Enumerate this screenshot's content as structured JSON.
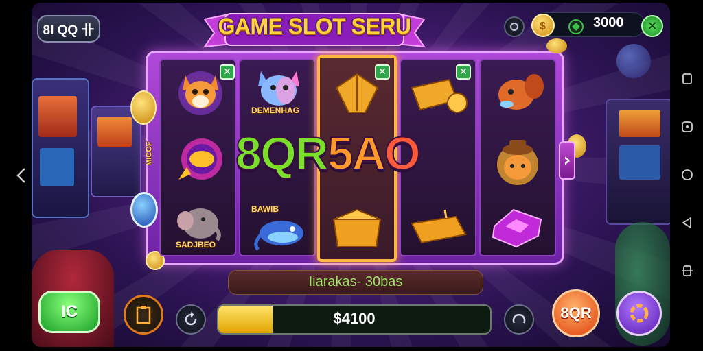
{
  "top": {
    "level_badge": "8I QQ 卝",
    "title": "GAME SLOT SERU",
    "credits": "3000"
  },
  "reels": {
    "big_win_text": [
      "8QR",
      "5A",
      "O"
    ],
    "labels": {
      "reel2_top": "DEMENHAG",
      "reel1_bottom": "SADJBEO",
      "reel2_bottom": "BAWIB",
      "side_left": "MICOF"
    }
  },
  "bottom": {
    "win_label": "Iiarakas- 30bas",
    "bet_amount": "$4100",
    "bet_fill": 0.2,
    "spin_button_label": "8QR",
    "left_button_label": "IC"
  },
  "icons": {
    "tick": "✕",
    "next_arrow": "›"
  },
  "colors": {
    "title_gold": "#ffd23c",
    "frame_purple": "#b04ad8",
    "win_green": "#9fe36a",
    "spin_orange": "#ff6a1a",
    "play_green": "#3bd84a"
  }
}
